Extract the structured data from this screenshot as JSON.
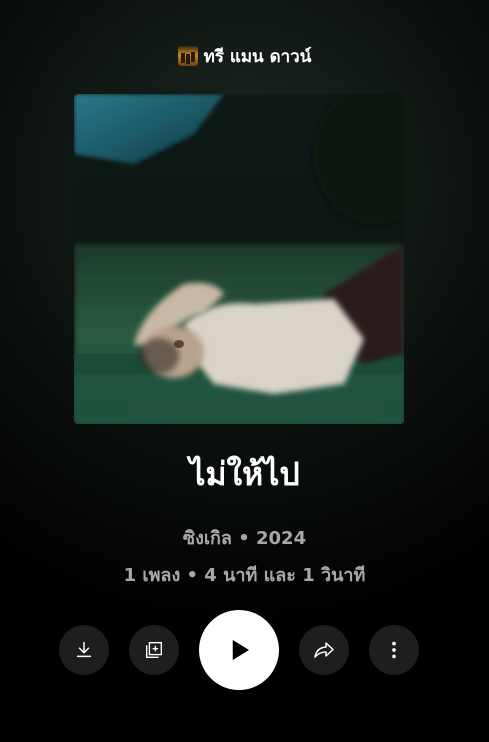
{
  "artist": {
    "name": "ทรี แมน ดาวน์",
    "thumbnail_icon": "artist-avatar"
  },
  "album": {
    "title": "ไม่ให้ไป",
    "meta_type_year": "ซิงเกิล • 2024",
    "meta_tracks_duration": "1 เพลง • 4 นาที และ 1 วินาที"
  },
  "controls": {
    "download_icon": "download-icon",
    "add_to_library_icon": "library-add-icon",
    "play_icon": "play-icon",
    "share_icon": "share-icon",
    "more_icon": "more-vert-icon"
  },
  "colors": {
    "background": "#000000",
    "control_bg": "#1e1e1e",
    "play_bg": "#ffffff",
    "meta_text": "#a8a8a8"
  }
}
